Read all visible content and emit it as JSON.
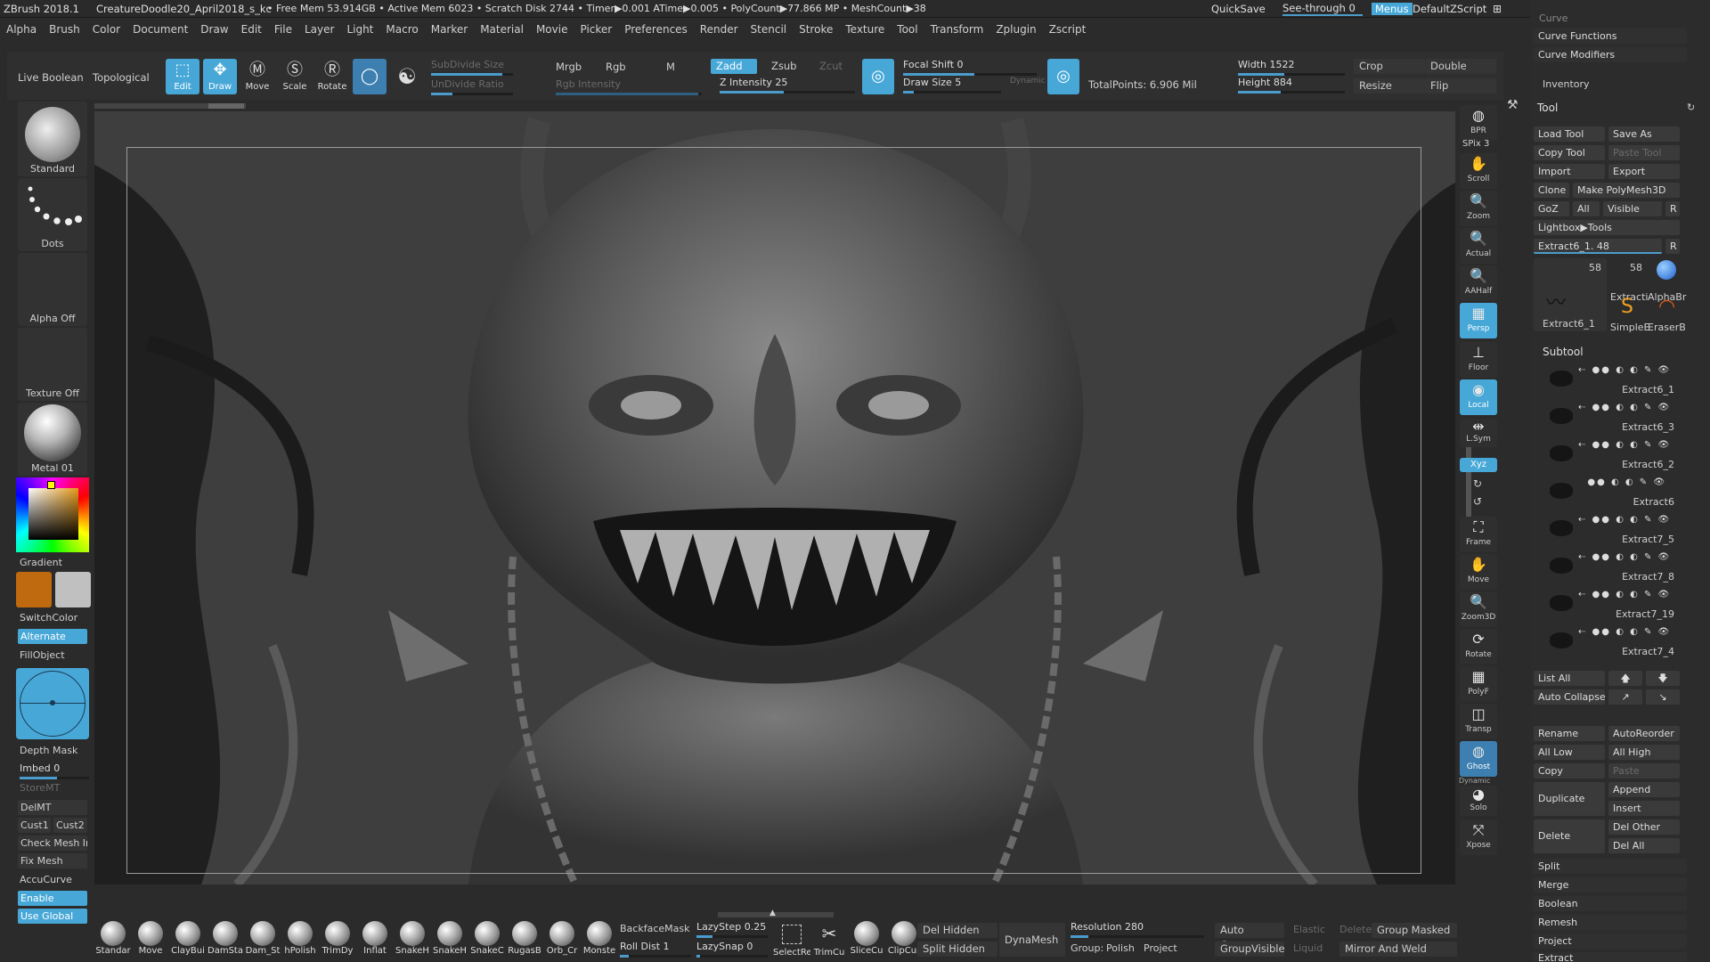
{
  "titlebar": {
    "app": "ZBrush 2018.1",
    "file": "CreatureDoodle20_April2018_s_kc",
    "stats": "• Free Mem 53.914GB • Active Mem 6023 • Scratch Disk 2744 • Timer▶0.001 ATime▶0.005 • PolyCount▶77.866 MP • MeshCount▶38",
    "quicksave": "QuickSave",
    "seethrough": "See-through  0",
    "menus": "Menus",
    "script": "DefaultZScript"
  },
  "menubar": [
    "Alpha",
    "Brush",
    "Color",
    "Document",
    "Draw",
    "Edit",
    "File",
    "Layer",
    "Light",
    "Macro",
    "Marker",
    "Material",
    "Movie",
    "Picker",
    "Preferences",
    "Render",
    "Stencil",
    "Stroke",
    "Texture",
    "Tool",
    "Transform",
    "Zplugin",
    "Zscript"
  ],
  "toolbar": {
    "live_boolean": "Live Boolean",
    "topological": "Topological",
    "edit": "Edit",
    "draw": "Draw",
    "move": "Move",
    "scale": "Scale",
    "rotate": "Rotate",
    "subdivide_size": "SubDivide Size",
    "undivide_ratio": "UnDivide Ratio",
    "mrgb": "Mrgb",
    "rgb": "Rgb",
    "m": "M",
    "rgb_intensity": "Rgb Intensity",
    "zadd": "Zadd",
    "zsub": "Zsub",
    "zcut": "Zcut",
    "z_intensity": "Z Intensity 25",
    "focal_shift": "Focal Shift 0",
    "draw_size": "Draw Size 5",
    "dynamic": "Dynamic",
    "total_points": "TotalPoints:  6.906 Mil",
    "width": "Width 1522",
    "height": "Height 884",
    "crop": "Crop",
    "resize": "Resize",
    "double": "Double",
    "flip": "Flip"
  },
  "leftshelf": {
    "brush": "Standard",
    "stroke": "Dots",
    "alpha": "Alpha Off",
    "texture": "Texture Off",
    "material": "Metal 01",
    "gradient": "Gradient",
    "switchcolor": "SwitchColor",
    "alternate": "Alternate",
    "fillobject": "FillObject",
    "depth_mask": "Depth Mask",
    "imbed": "Imbed 0",
    "storemt": "StoreMT",
    "delmt": "DelMT",
    "cust1": "Cust1",
    "cust2": "Cust2",
    "check_mesh": "Check Mesh In",
    "fix_mesh": "Fix Mesh",
    "accucurve": "AccuCurve",
    "enable": "Enable",
    "use_global": "Use Global",
    "colors": {
      "main": "#c06a10",
      "secondary": "#c0c0c0",
      "accent": "#47a8d8"
    }
  },
  "rightshelf": [
    {
      "name": "bpr-button",
      "label": "BPR",
      "icon": "bpr-icon"
    },
    {
      "name": "spix",
      "label": "SPix 3"
    },
    {
      "name": "scroll-button",
      "label": "Scroll"
    },
    {
      "name": "zoom-button",
      "label": "Zoom"
    },
    {
      "name": "actual-button",
      "label": "Actual"
    },
    {
      "name": "aahalf-button",
      "label": "AAHalf"
    },
    {
      "name": "persp-button",
      "label": "Persp"
    },
    {
      "name": "floor-button",
      "label": "Floor"
    },
    {
      "name": "local-button",
      "label": "Local"
    },
    {
      "name": "lsym-button",
      "label": "L.Sym"
    },
    {
      "name": "xyz-button",
      "label": "Xyz"
    },
    {
      "name": "frame-button",
      "label": "Frame"
    },
    {
      "name": "move-view-button",
      "label": "Move"
    },
    {
      "name": "zoom3d-button",
      "label": "Zoom3D"
    },
    {
      "name": "rotate-view-button",
      "label": "Rotate"
    },
    {
      "name": "polyf-button",
      "label": "PolyF"
    },
    {
      "name": "transp-button",
      "label": "Transp"
    },
    {
      "name": "ghost-button",
      "label": "Ghost"
    },
    {
      "name": "solo-button",
      "label": "Solo"
    },
    {
      "name": "dynamic-label",
      "label": "Dynamic"
    },
    {
      "name": "xpose-button",
      "label": "Xpose"
    }
  ],
  "bottomshelf": {
    "brushes": [
      "Standar",
      "Move",
      "ClayBui",
      "DamSta",
      "Dam_St",
      "hPolish",
      "TrimDy",
      "Inflat",
      "SnakeH",
      "SnakeH",
      "SnakeC",
      "RugasB",
      "Orb_Cr",
      "Monste"
    ],
    "backface": "BackfaceMask",
    "rolldist": "Roll Dist 1",
    "lazystep": "LazyStep 0.25",
    "lazysnap": "LazySnap 0",
    "tools": [
      "SelectRe",
      "TrimCu",
      "SliceCu",
      "ClipCur"
    ],
    "del_hidden": "Del Hidden",
    "split_hidden": "Split Hidden",
    "dynamesh": "DynaMesh",
    "resolution": "Resolution 280",
    "group": "Group:",
    "polish": "Polish",
    "project": "Project",
    "auto_groups": "Auto Groups",
    "groupvisible": "GroupVisible",
    "elastic": "Elastic",
    "liquid": "Liquid",
    "delete": "Delete",
    "group_masked": "Group Masked",
    "mirror_weld": "Mirror And Weld"
  },
  "palette": {
    "curve": "Curve",
    "curve_functions": "Curve Functions",
    "curve_modifiers": "Curve Modifiers",
    "inventory": "Inventory",
    "tool": "Tool",
    "load_tool": "Load Tool",
    "save_as": "Save As",
    "copy_tool": "Copy Tool",
    "paste_tool": "Paste Tool",
    "import": "Import",
    "export": "Export",
    "clone": "Clone",
    "make_polymesh": "Make PolyMesh3D",
    "goz": "GoZ",
    "all": "All",
    "visible": "Visible",
    "r": "R",
    "lightbox": "Lightbox▶Tools",
    "current_tool": "Extract6_1. 48",
    "thumb_count1": "58",
    "thumb_count2": "58",
    "thumb_labels": [
      "Extract6_1",
      "Extracti",
      "AlphaBr",
      "SimpleE",
      "EraserB"
    ],
    "subtool": "Subtool",
    "subtools": [
      "Extract6_1",
      "Extract6_3",
      "Extract6_2",
      "Extract6",
      "Extract7_5",
      "Extract7_8",
      "Extract7_19",
      "Extract7_4"
    ],
    "list_all": "List All",
    "auto_collapse": "Auto Collapse",
    "rename": "Rename",
    "autoreorder": "AutoReorder",
    "all_low": "All Low",
    "all_high": "All High",
    "copy": "Copy",
    "paste": "Paste",
    "duplicate": "Duplicate",
    "append": "Append",
    "insert": "Insert",
    "delete": "Delete",
    "del_other": "Del Other",
    "del_all": "Del All",
    "split": "Split",
    "merge": "Merge",
    "boolean": "Boolean",
    "remesh": "Remesh",
    "project": "Project",
    "extract": "Extract"
  }
}
